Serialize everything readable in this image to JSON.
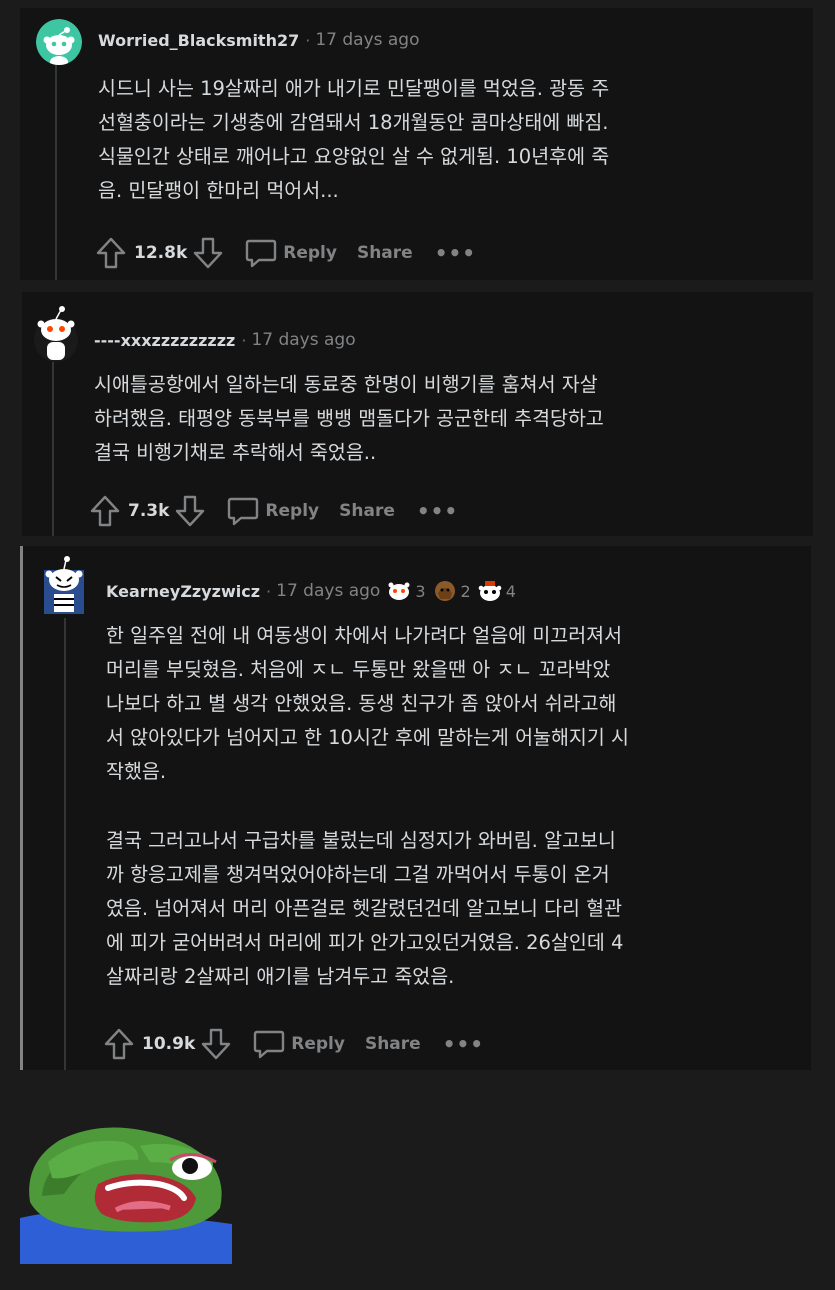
{
  "comments": [
    {
      "user": "Worried_Blacksmith27",
      "time": "17 days ago",
      "body": [
        "시드니 사는 19살짜리 애가 내기로 민달팽이를 먹었음. 광동 주",
        "선혈충이라는 기생충에 감염돼서 18개월동안 콤마상태에 빠짐.",
        "식물인간 상태로 깨어나고 요양없인 살 수 없게됨. 10년후에 죽",
        "음. 민달팽이 한마리 먹어서..."
      ],
      "score": "12.8k",
      "reply": "Reply",
      "share": "Share",
      "more": "•••"
    },
    {
      "user": "----xxxzzzzzzzzz",
      "time": "17 days ago",
      "body": [
        "시애틀공항에서 일하는데 동료중 한명이 비행기를 훔쳐서 자살",
        "하려했음. 태평양 동북부를 뱅뱅 맴돌다가 공군한테 추격당하고",
        "결국 비행기채로 추락해서 죽었음.."
      ],
      "score": "7.3k",
      "reply": "Reply",
      "share": "Share",
      "more": "•••"
    },
    {
      "user": "KearneyZzyzwicz",
      "time": "17 days ago",
      "awards": [
        {
          "icon": "snoo-award-icon",
          "count": "3"
        },
        {
          "icon": "facepalm-award-icon",
          "count": "2"
        },
        {
          "icon": "helpful-award-icon",
          "count": "4"
        }
      ],
      "body": [
        "한 일주일 전에 내 여동생이 차에서 나가려다 얼음에 미끄러져서",
        "머리를 부딪혔음. 처음에 ㅈㄴ 두통만 왔을땐 아 ㅈㄴ 꼬라박았",
        "나보다 하고 별 생각 안했었음. 동생 친구가 좀 앉아서 쉬라고해",
        "서 앉아있다가 넘어지고 한 10시간 후에 말하는게 어눌해지기 시",
        "작했음."
      ],
      "body2": [
        "결국 그러고나서 구급차를 불렀는데 심정지가 와버림. 알고보니",
        "까 항응고제를 챙겨먹었어야하는데 그걸 까먹어서 두통이 온거",
        "였음. 넘어져서 머리 아픈걸로 헷갈렸던건데 알고보니 다리 혈관",
        "에 피가 굳어버려서 머리에 피가 안가고있던거였음. 26살인데 4",
        "살짜리랑 2살짜리 애기를 남겨두고 죽었음."
      ],
      "score": "10.9k",
      "reply": "Reply",
      "share": "Share",
      "more": "•••"
    }
  ],
  "colors": {
    "background": "#1b1b1c",
    "card": "#131314",
    "text": "#d7dadc",
    "muted": "#818384"
  }
}
